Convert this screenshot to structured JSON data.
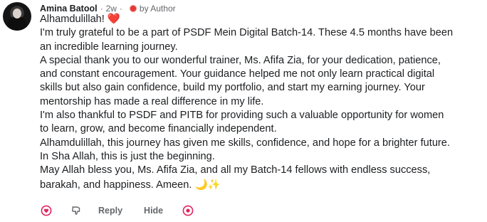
{
  "comment": {
    "author": "Amina Batool",
    "separator": "·",
    "time": "2w",
    "badge_label": "by Author",
    "badge_color": "#e53935",
    "paragraphs": [
      {
        "text": "Alhamdulillah!",
        "emoji": "❤️",
        "emoji_name": "red-heart-emoji"
      },
      {
        "text": "I'm truly grateful to be a part of PSDF Mein Digital Batch-14. These 4.5 months have been"
      },
      {
        "text": "an incredible learning journey."
      },
      {
        "text": "A special thank you to our wonderful trainer, Ms. Afifa Zia, for your dedication, patience,"
      },
      {
        "text": "and constant encouragement. Your guidance helped me not only learn practical digital"
      },
      {
        "text": "skills but also gain confidence, build my portfolio, and start my earning journey. Your"
      },
      {
        "text": "mentorship has made a real difference in my life."
      },
      {
        "text": "I'm also thankful to PSDF and PITB for providing such a valuable opportunity for women"
      },
      {
        "text": "to learn, grow, and become financially independent."
      },
      {
        "text": "Alhamdulillah, this journey has given me skills, confidence, and hope for a brighter future."
      },
      {
        "text": "In Sha Allah, this is just the beginning."
      },
      {
        "text": "May Allah bless you, Ms. Afifa Zia, and all my Batch-14 fellows with endless success,"
      },
      {
        "text": "barakah, and happiness. Ameen.",
        "emoji": "🌙✨",
        "emoji_name": "moon-sparkles-emoji"
      }
    ]
  },
  "actions": {
    "like_icon": "like-reaction-icon",
    "dislike_icon": "dislike-thumb-icon",
    "reply_label": "Reply",
    "hide_label": "Hide",
    "emoji_icon": "add-reaction-icon"
  },
  "colors": {
    "text": "#1c1e21",
    "muted": "#65676b",
    "accent_red": "#e53935"
  }
}
